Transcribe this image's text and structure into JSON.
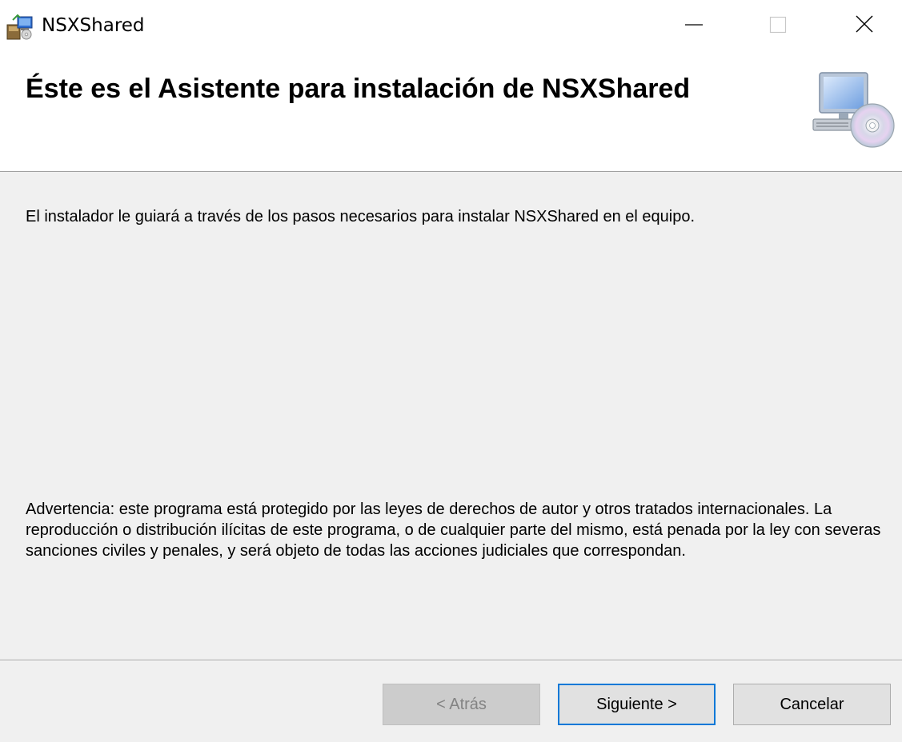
{
  "window": {
    "title": "NSXShared",
    "icon": "installer-package-icon",
    "controls": {
      "minimize": "minimize-icon",
      "maximize": "maximize-icon",
      "close": "close-icon"
    }
  },
  "banner": {
    "title": "Éste es el Asistente para instalación de NSXShared",
    "icon": "computer-cd-icon"
  },
  "body": {
    "intro": "El instalador le guiará a través de los pasos necesarios para instalar NSXShared en el equipo.",
    "warning": "Advertencia: este programa está protegido por las leyes de derechos de autor y otros tratados internacionales. La reproducción o distribución ilícitas de este programa, o de cualquier parte del mismo, está penada por la ley con severas sanciones civiles y penales, y será objeto de todas las acciones judiciales que correspondan."
  },
  "buttons": {
    "back": "< Atrás",
    "next": "Siguiente >",
    "cancel": "Cancelar"
  },
  "colors": {
    "window_bg": "#f0f0f0",
    "banner_bg": "#ffffff",
    "focus_border": "#0078d7",
    "disabled_text": "#838383"
  }
}
